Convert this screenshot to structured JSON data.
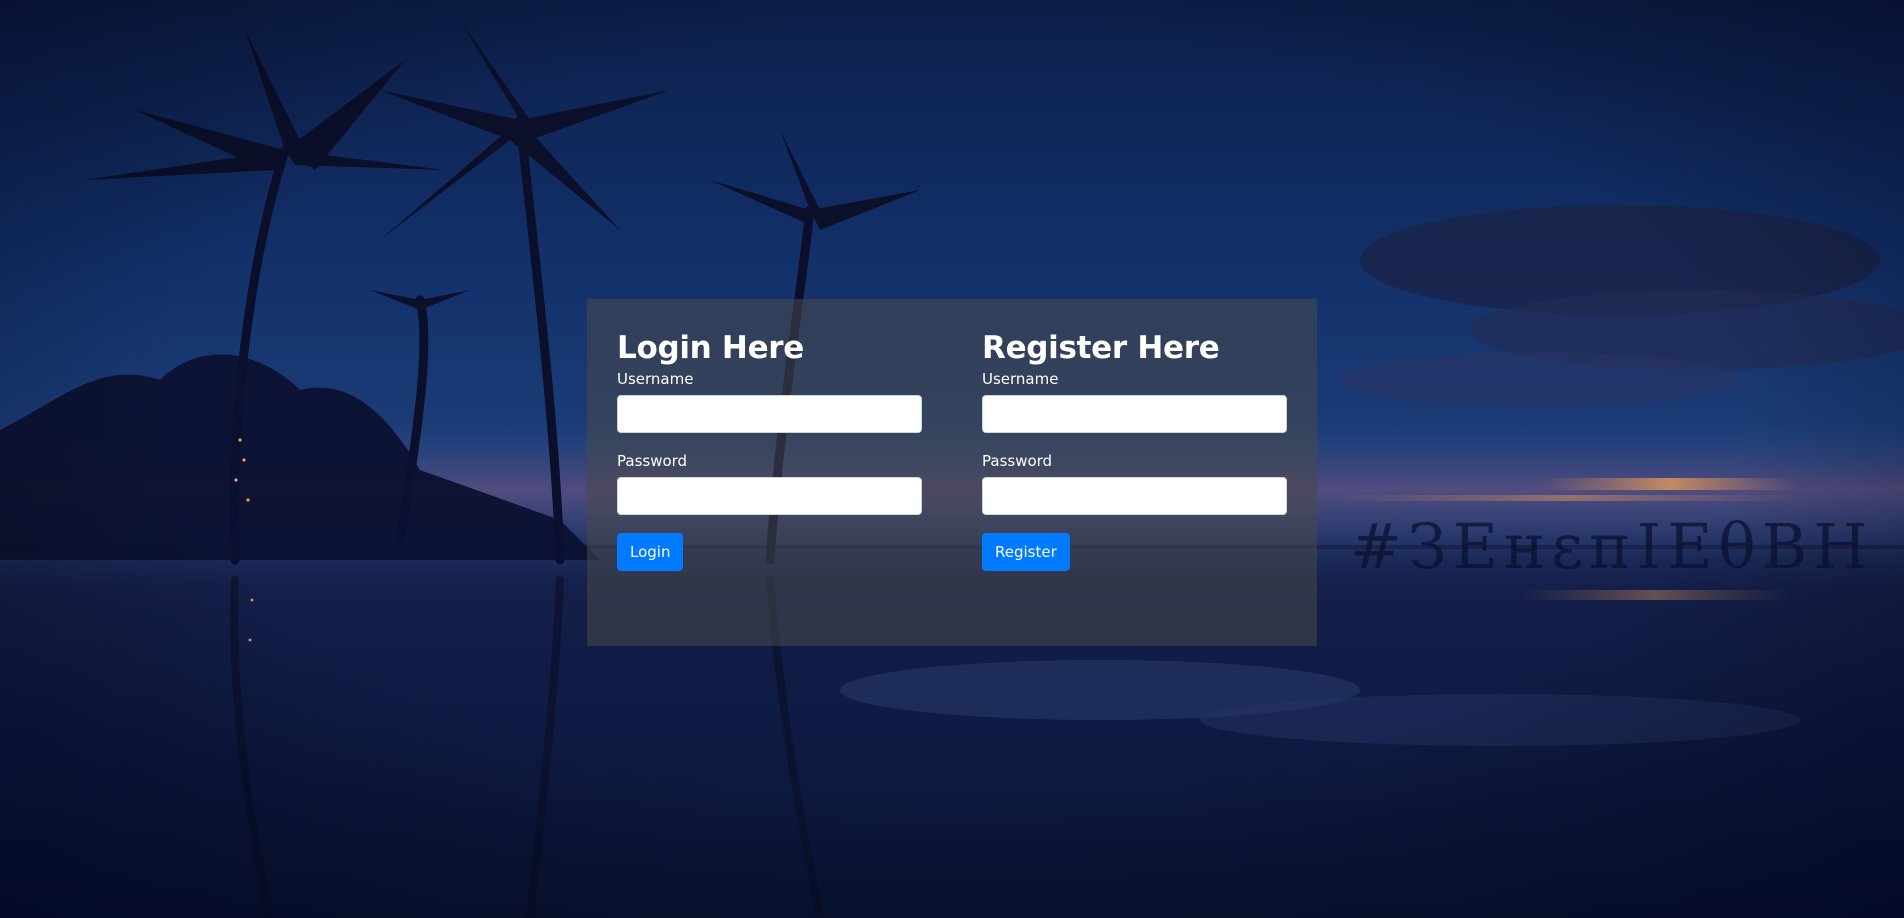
{
  "login": {
    "title": "Login Here",
    "username_label": "Username",
    "username_value": "",
    "password_label": "Password",
    "password_value": "",
    "button_label": "Login"
  },
  "register": {
    "title": "Register Here",
    "username_label": "Username",
    "username_value": "",
    "password_label": "Password",
    "password_value": "",
    "button_label": "Register"
  },
  "colors": {
    "button": "#007bff",
    "panel": "rgba(72,72,72,0.55)",
    "text": "#ffffff"
  }
}
